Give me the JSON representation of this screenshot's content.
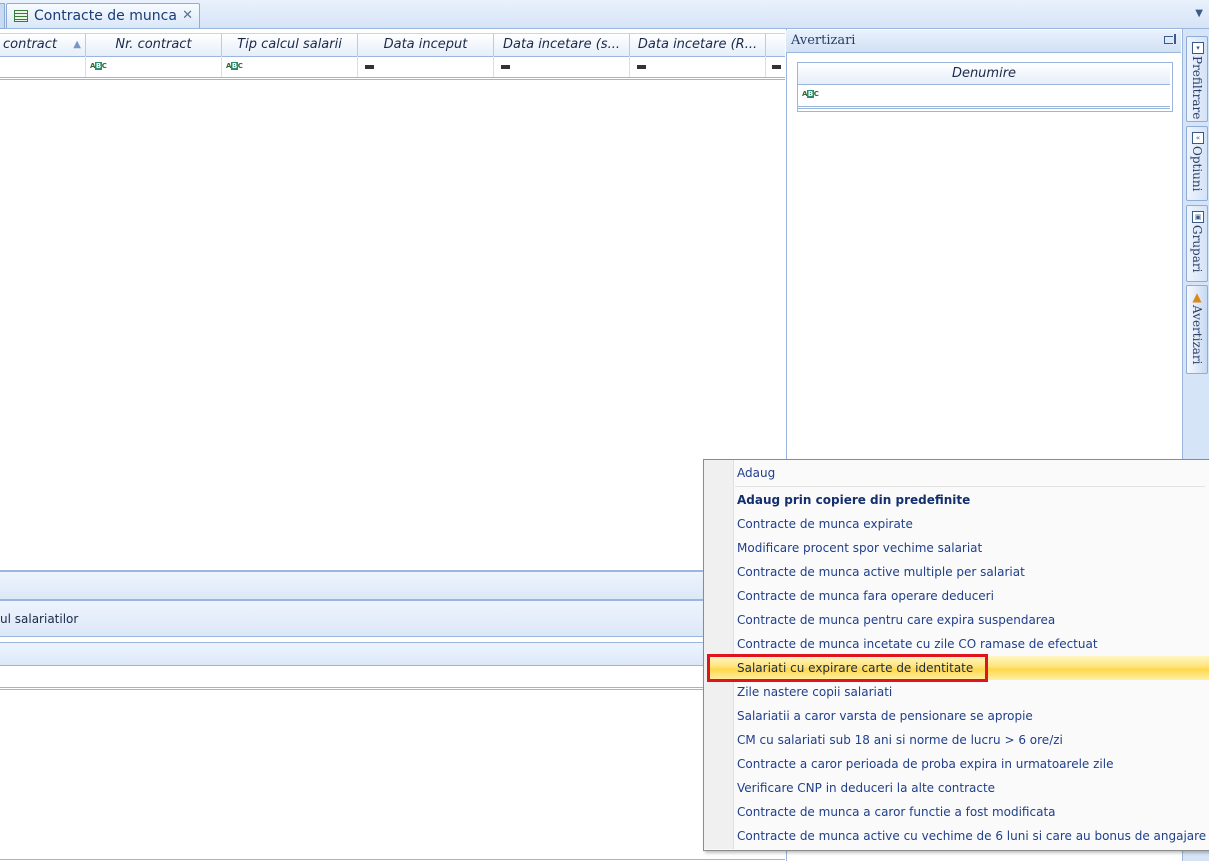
{
  "tab": {
    "title": "Contracte de munca",
    "close": "✕"
  },
  "grid": {
    "columns": [
      {
        "label": "contract",
        "sorted": true
      },
      {
        "label": "Nr. contract"
      },
      {
        "label": "Tip calcul salarii"
      },
      {
        "label": "Data inceput"
      },
      {
        "label": "Data incetare (s..."
      },
      {
        "label": "Data incetare (R..."
      }
    ],
    "filter_abc": "ABC"
  },
  "lower": {
    "band2_text": "ul salariatilor"
  },
  "right_panel": {
    "title": "Avertizari",
    "column": "Denumire",
    "filter_abc": "ABC"
  },
  "side_tabs": [
    {
      "label": "Prefiltrare",
      "icon": "filter-icon"
    },
    {
      "label": "Optiuni",
      "icon": "options-icon"
    },
    {
      "label": "Grupari",
      "icon": "group-icon"
    },
    {
      "label": "Avertizari",
      "icon": "warning-icon"
    }
  ],
  "context_menu": {
    "items": [
      {
        "label": "Adaug",
        "bold": false
      },
      {
        "label": "Adaug prin copiere din predefinite",
        "bold": true
      },
      {
        "label": "Contracte de munca expirate"
      },
      {
        "label": "Modificare procent spor vechime salariat"
      },
      {
        "label": "Contracte de munca active multiple per salariat"
      },
      {
        "label": "Contracte de munca fara operare deduceri"
      },
      {
        "label": "Contracte de munca pentru care expira suspendarea"
      },
      {
        "label": "Contracte de munca incetate cu zile CO ramase de efectuat"
      },
      {
        "label": "Salariati cu expirare carte de identitate",
        "highlighted": true
      },
      {
        "label": "Zile nastere copii salariati"
      },
      {
        "label": "Salariatii a caror varsta de pensionare se apropie"
      },
      {
        "label": "CM cu salariati sub 18 ani si norme de lucru > 6 ore/zi"
      },
      {
        "label": "Contracte a caror perioada de proba expira in urmatoarele zile"
      },
      {
        "label": "Verificare CNP in deduceri la alte contracte"
      },
      {
        "label": "Contracte de munca a caror functie a fost modificata"
      },
      {
        "label": "Contracte de munca active cu vechime de 6 luni si care au bonus de angajare"
      }
    ]
  },
  "colors": {
    "highlight": "#ffd84a",
    "annotation": "#e0141d",
    "accent": "#9bb6dd"
  }
}
